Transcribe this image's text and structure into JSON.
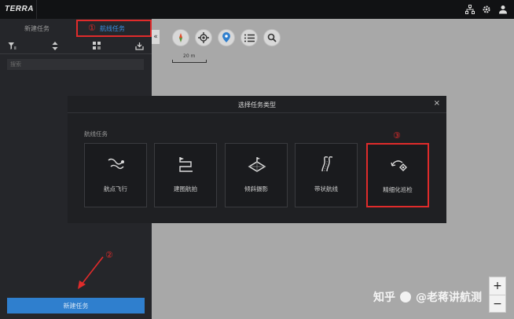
{
  "app": {
    "name": "TERRA"
  },
  "tabs": [
    {
      "label": "新建任务"
    },
    {
      "label": "航线任务"
    }
  ],
  "search": {
    "placeholder": "搜索"
  },
  "new_task_button": "新建任务",
  "map": {
    "scale_label": "20 m",
    "collapse_glyph": "«"
  },
  "dialog": {
    "title": "选择任务类型",
    "close": "×",
    "section_label": "航线任务",
    "types": [
      {
        "label": "航点飞行",
        "icon": "waypoint-flight-icon"
      },
      {
        "label": "建图航拍",
        "icon": "mapping-aerial-icon"
      },
      {
        "label": "倾斜摄影",
        "icon": "oblique-photo-icon"
      },
      {
        "label": "带状航线",
        "icon": "corridor-route-icon"
      },
      {
        "label": "精细化巡检",
        "icon": "fine-inspection-icon"
      }
    ]
  },
  "annotations": {
    "one": "①",
    "two": "②",
    "three": "③"
  },
  "watermark": {
    "site": "知乎",
    "author": "@老蒋讲航测"
  },
  "zoom": {
    "in": "+",
    "out": "−"
  },
  "colors": {
    "accent": "#2f7fce",
    "highlight": "#e02b2b",
    "panel": "#25262a",
    "dialog": "#1f2023",
    "map": "#a8a8a8"
  }
}
